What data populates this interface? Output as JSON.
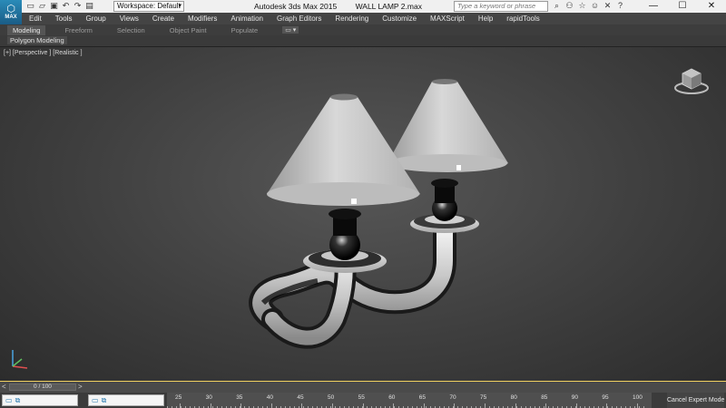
{
  "titlebar": {
    "logo_text": "MAX",
    "workspace": "Workspace: Default",
    "app_title": "Autodesk 3ds Max  2015",
    "file_name": "WALL LAMP 2.max",
    "search_placeholder": "Type a keyword or phrase",
    "quick_icons": [
      "new-icon",
      "open-icon",
      "save-icon",
      "undo-icon",
      "redo-icon",
      "project-icon"
    ],
    "help_icons": [
      "search-icon",
      "binoculars-icon",
      "star-icon",
      "user-icon",
      "close-x-icon",
      "help-icon"
    ],
    "window_controls": [
      "—",
      "☐",
      "✕"
    ]
  },
  "menubar": {
    "items": [
      "Edit",
      "Tools",
      "Group",
      "Views",
      "Create",
      "Modifiers",
      "Animation",
      "Graph Editors",
      "Rendering",
      "Customize",
      "MAXScript",
      "Help",
      "rapidTools"
    ]
  },
  "ribbon": {
    "tabs": [
      "Modeling",
      "Freeform",
      "Selection",
      "Object Paint",
      "Populate"
    ],
    "active_tab": "Modeling",
    "options_icon": "▭ ▾",
    "panel_label": "Polygon Modeling"
  },
  "viewport": {
    "label": "[+] [Perspective ] [Realistic ]",
    "object": "wall-lamp",
    "background_color": "#4a4a4a"
  },
  "timeline": {
    "slider_text": "0 / 100",
    "prev_arrow": "<",
    "next_arrow": ">"
  },
  "statusbar": {
    "ruler_labels": [
      "25",
      "30",
      "35",
      "40",
      "45",
      "50",
      "55",
      "60",
      "65",
      "70",
      "75",
      "80",
      "85",
      "90",
      "95",
      "100"
    ],
    "cancel_expert_mode": "Cancel Expert Mode"
  }
}
